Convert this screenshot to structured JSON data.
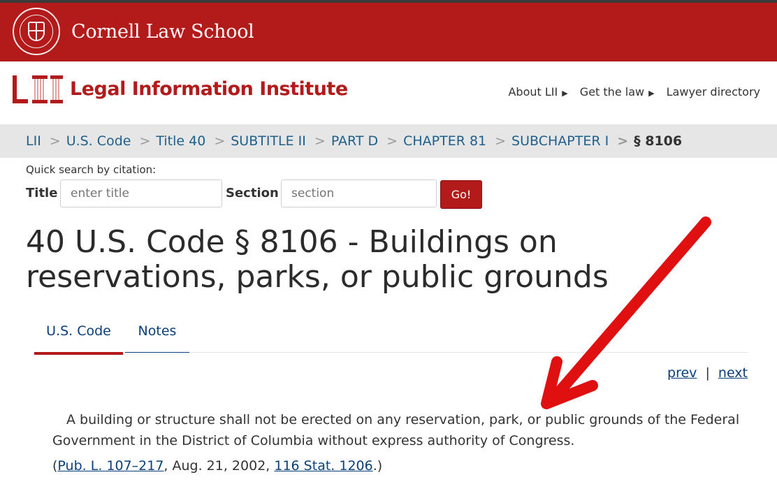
{
  "cornell": {
    "name": "Cornell Law School",
    "seal_icon": "cornell-seal-icon"
  },
  "header": {
    "logo_letters": "LII",
    "title": "Legal Information Institute",
    "nav": [
      "About LII",
      "Get the law",
      "Lawyer directory"
    ]
  },
  "breadcrumbs": [
    "LII",
    "U.S. Code",
    "Title 40",
    "SUBTITLE II",
    "PART D",
    "CHAPTER 81",
    "SUBCHAPTER I",
    "§ 8106"
  ],
  "quick_search": {
    "label": "Quick search by citation:",
    "title_label": "Title",
    "title_placeholder": "enter title",
    "section_label": "Section",
    "section_placeholder": "section",
    "go_label": "Go!"
  },
  "page_title": "40 U.S. Code § 8106 - Buildings on reservations, parks, or public grounds",
  "tabs": [
    {
      "label": "U.S. Code",
      "active": true
    },
    {
      "label": "Notes",
      "active": false
    }
  ],
  "pager": {
    "prev": "prev",
    "separator": "|",
    "next": "next"
  },
  "body": "A building or structure shall not be erected on any reservation, park, or public grounds of the Federal Government in the District of Columbia without express authority of Congress.",
  "citation": {
    "open": "(",
    "pub_law": "Pub. L. 107–217",
    "date": ", Aug. 21, 2002, ",
    "stat": "116 Stat. 1206",
    "close": ".)"
  },
  "colors": {
    "brand_red": "#b31b1b",
    "link_blue": "#0a3f7a",
    "crumb_blue": "#1f5f8b",
    "annotation_arrow": "#e01010"
  }
}
